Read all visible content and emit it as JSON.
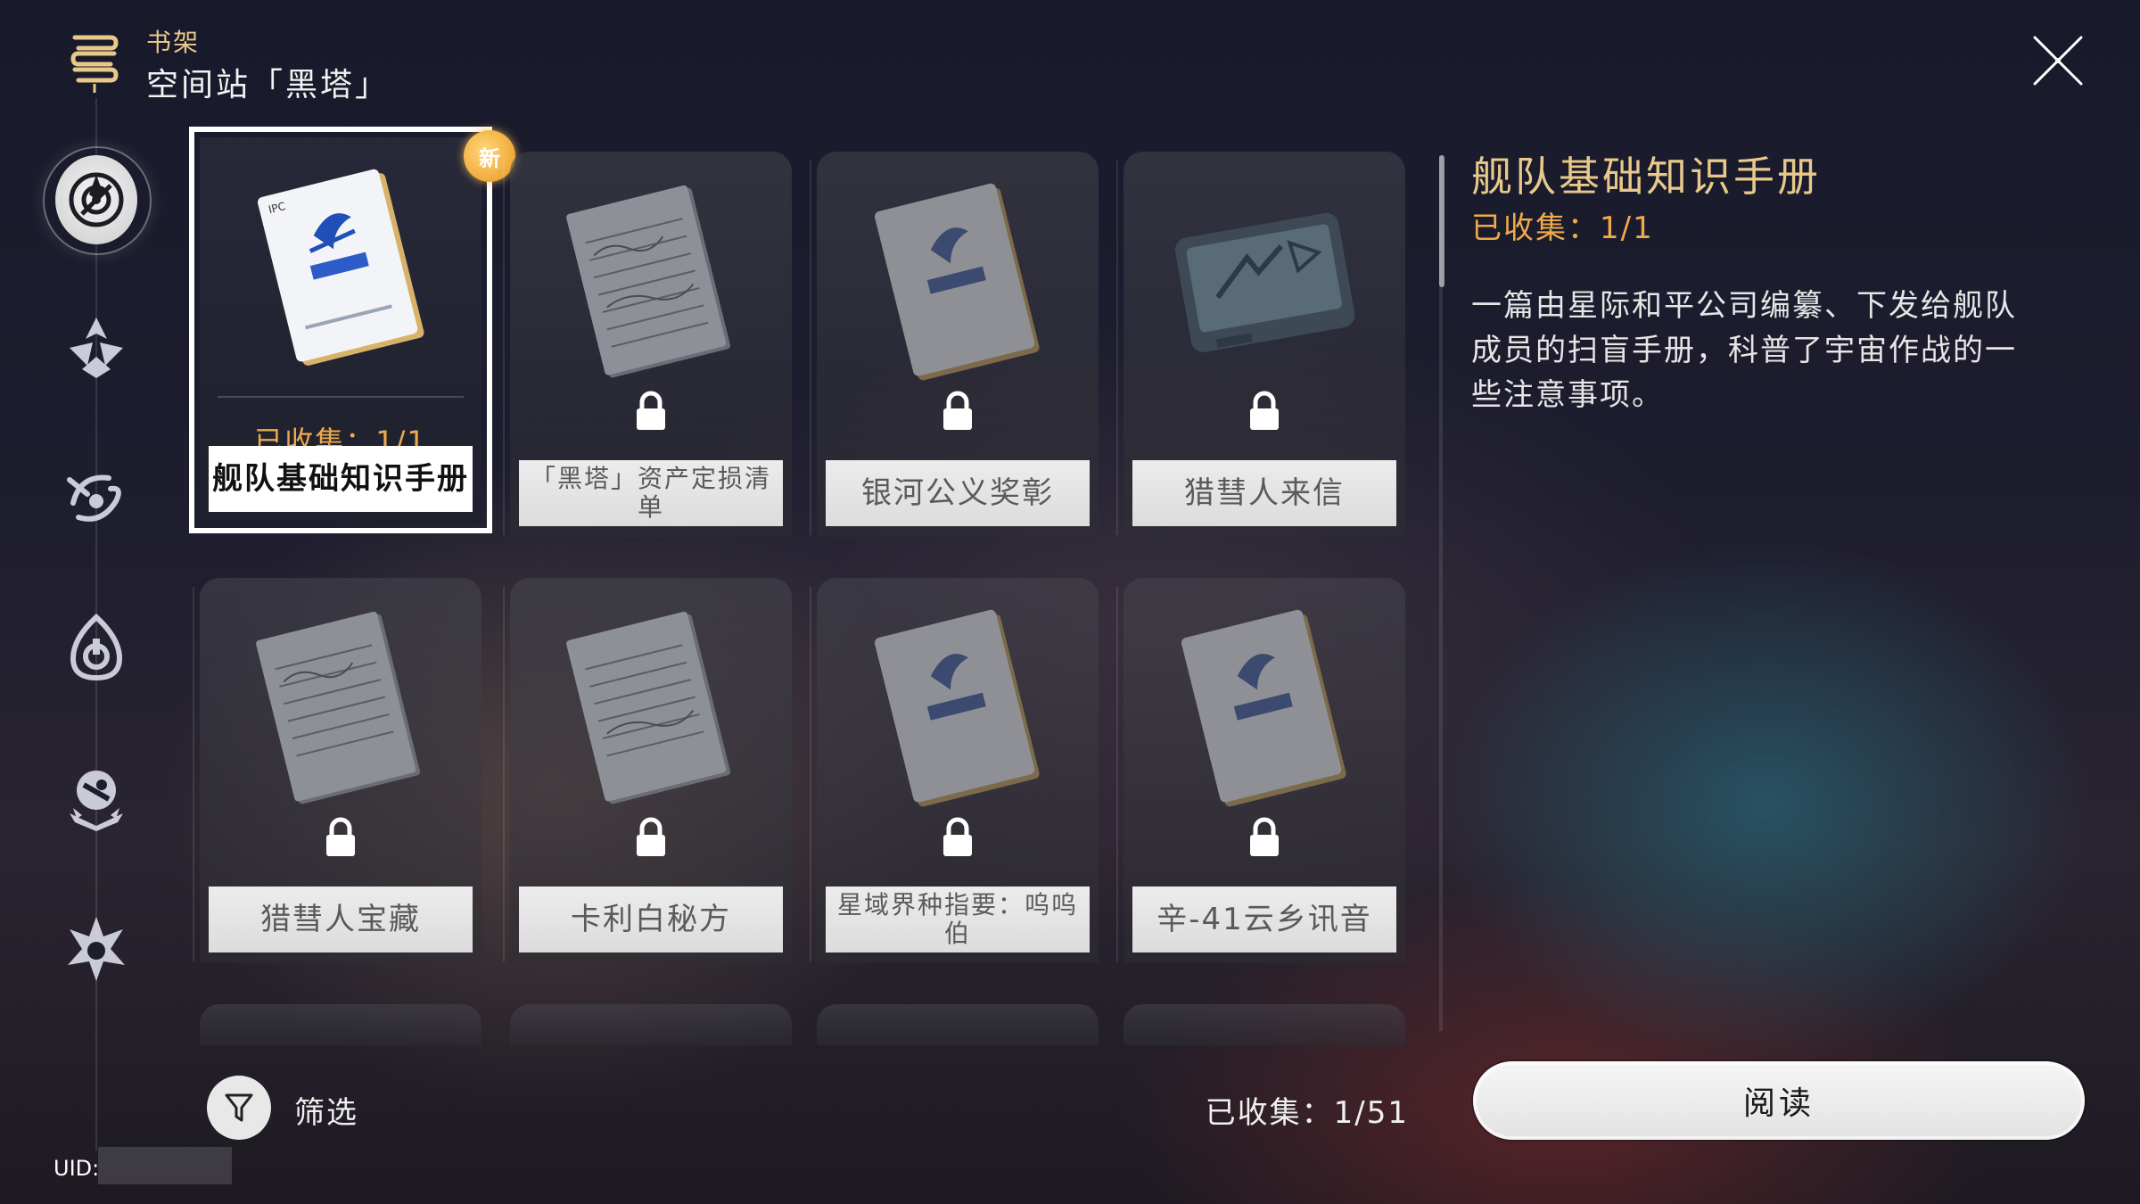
{
  "header": {
    "section": "书架",
    "title": "空间站「黑塔」",
    "icon": "books-icon"
  },
  "close": {
    "icon": "close-icon"
  },
  "sidebar": {
    "items": [
      {
        "name": "herta-space-station-icon",
        "active": true
      },
      {
        "name": "jarilo-vi-icon",
        "active": false
      },
      {
        "name": "xianzhou-luofu-icon",
        "active": false
      },
      {
        "name": "penacony-icon",
        "active": false
      },
      {
        "name": "simulated-universe-icon",
        "active": false
      },
      {
        "name": "misc-world-icon",
        "active": false
      }
    ]
  },
  "books": [
    {
      "title": "舰队基础知识手册",
      "collected": "已收集：1/1",
      "selected": true,
      "is_new": true,
      "new_label": "新",
      "locked": false,
      "cover": "manual"
    },
    {
      "title": "「黑塔」资产定损清单",
      "locked": true,
      "cover": "notes"
    },
    {
      "title": "银河公义奖彰",
      "locked": true,
      "cover": "manual"
    },
    {
      "title": "猎彗人来信",
      "locked": true,
      "cover": "tablet"
    },
    {
      "title": "猎彗人宝藏",
      "locked": true,
      "cover": "notes"
    },
    {
      "title": "卡利白秘方",
      "locked": true,
      "cover": "notes"
    },
    {
      "title": "星域界种指要：呜呜伯",
      "locked": true,
      "cover": "manual"
    },
    {
      "title": "辛-41云乡讯音",
      "locked": true,
      "cover": "manual"
    }
  ],
  "detail": {
    "title": "舰队基础知识手册",
    "collected": "已收集：1/1",
    "description": "一篇由星际和平公司编纂、下发给舰队成员的扫盲手册，科普了宇宙作战的一些注意事项。",
    "read_label": "阅读"
  },
  "footer": {
    "filter_label": "筛选",
    "total_collected": "已收集：1/51",
    "uid_label": "UID:"
  },
  "colors": {
    "accent_gold": "#e8c98a",
    "accent_orange": "#f0a94b",
    "new_badge": "#f0a93a"
  }
}
